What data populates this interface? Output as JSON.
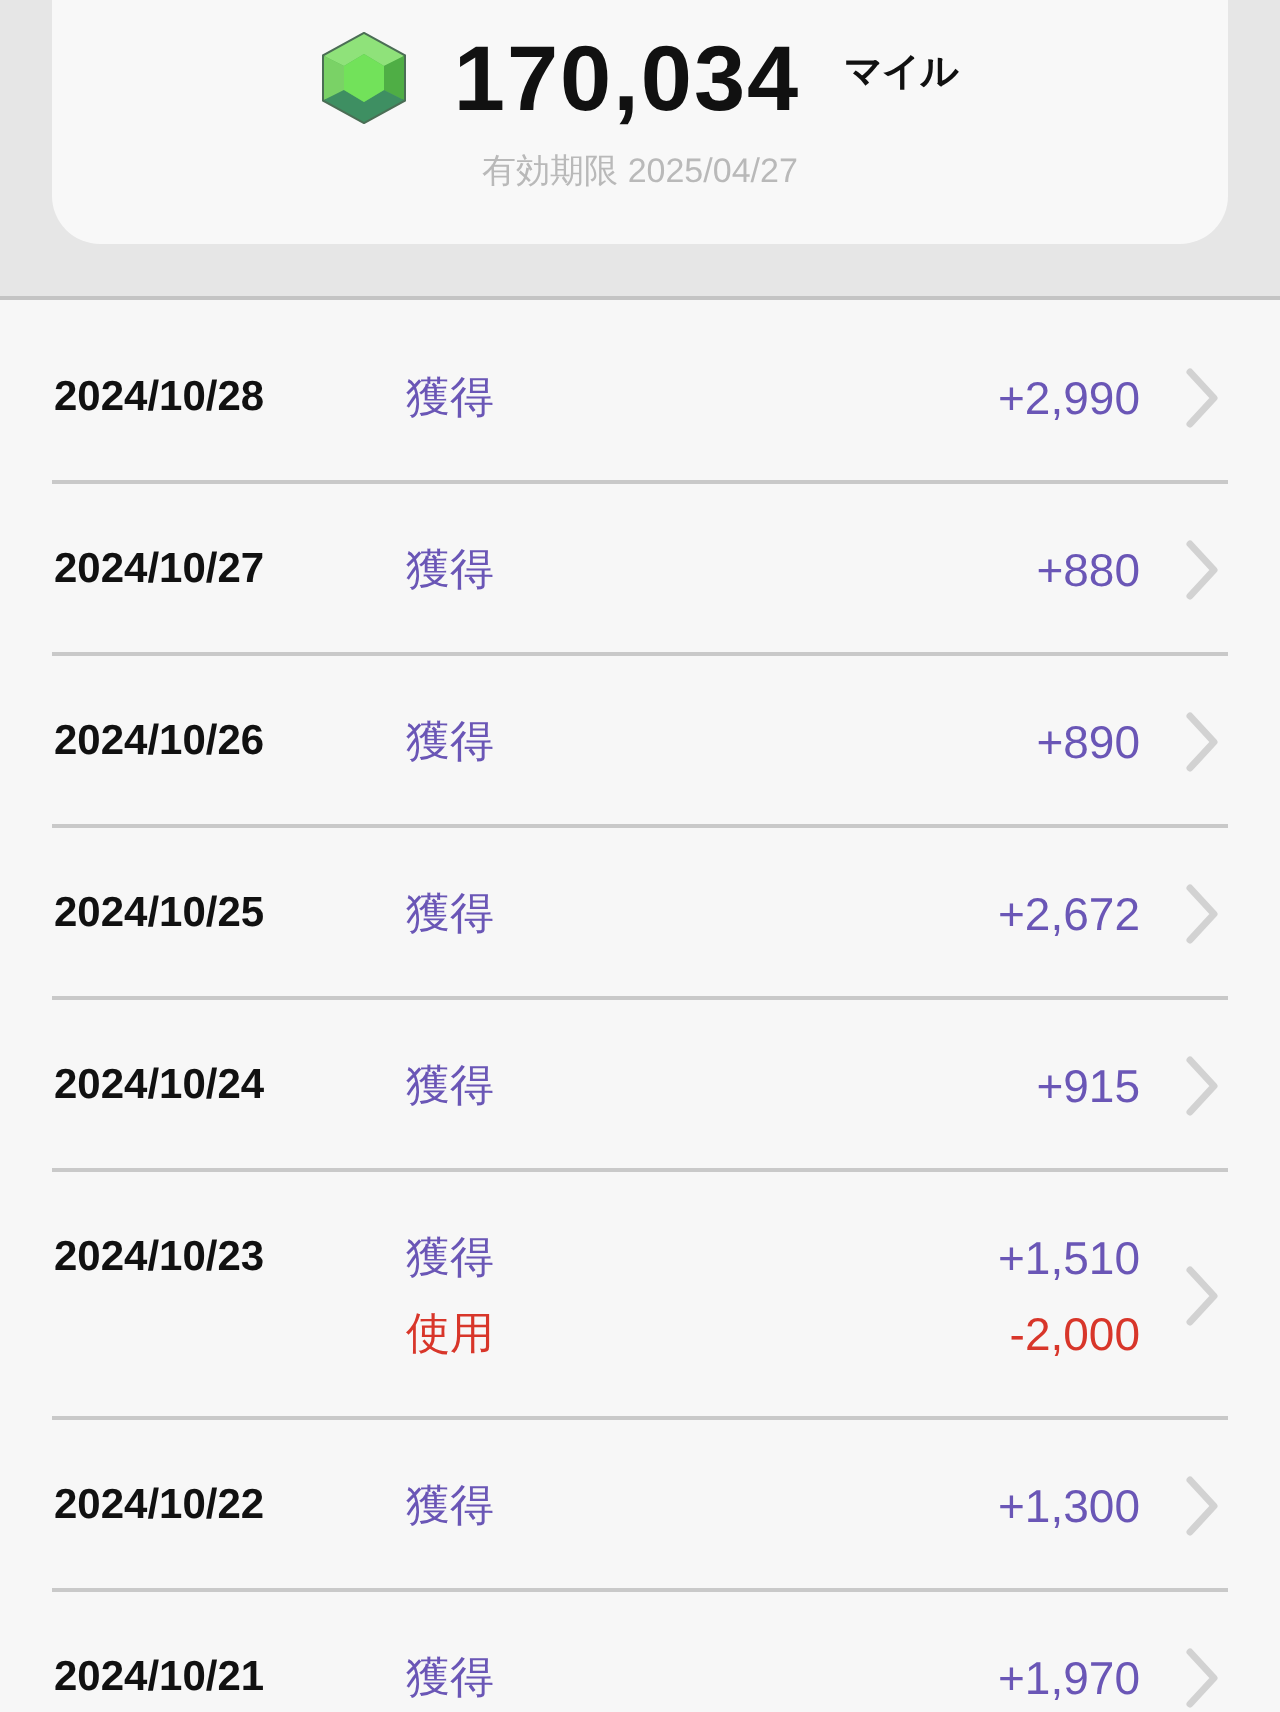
{
  "balance": {
    "amount": "170,034",
    "unit": "マイル",
    "expiry": "有効期限 2025/04/27"
  },
  "history": [
    {
      "date": "2024/10/28",
      "entries": [
        {
          "kind": "earn",
          "label": "獲得",
          "amount": "+2,990"
        }
      ]
    },
    {
      "date": "2024/10/27",
      "entries": [
        {
          "kind": "earn",
          "label": "獲得",
          "amount": "+880"
        }
      ]
    },
    {
      "date": "2024/10/26",
      "entries": [
        {
          "kind": "earn",
          "label": "獲得",
          "amount": "+890"
        }
      ]
    },
    {
      "date": "2024/10/25",
      "entries": [
        {
          "kind": "earn",
          "label": "獲得",
          "amount": "+2,672"
        }
      ]
    },
    {
      "date": "2024/10/24",
      "entries": [
        {
          "kind": "earn",
          "label": "獲得",
          "amount": "+915"
        }
      ]
    },
    {
      "date": "2024/10/23",
      "entries": [
        {
          "kind": "earn",
          "label": "獲得",
          "amount": "+1,510"
        },
        {
          "kind": "use",
          "label": "使用",
          "amount": "-2,000"
        }
      ]
    },
    {
      "date": "2024/10/22",
      "entries": [
        {
          "kind": "earn",
          "label": "獲得",
          "amount": "+1,300"
        }
      ]
    },
    {
      "date": "2024/10/21",
      "entries": [
        {
          "kind": "earn",
          "label": "獲得",
          "amount": "+1,970"
        }
      ]
    }
  ]
}
